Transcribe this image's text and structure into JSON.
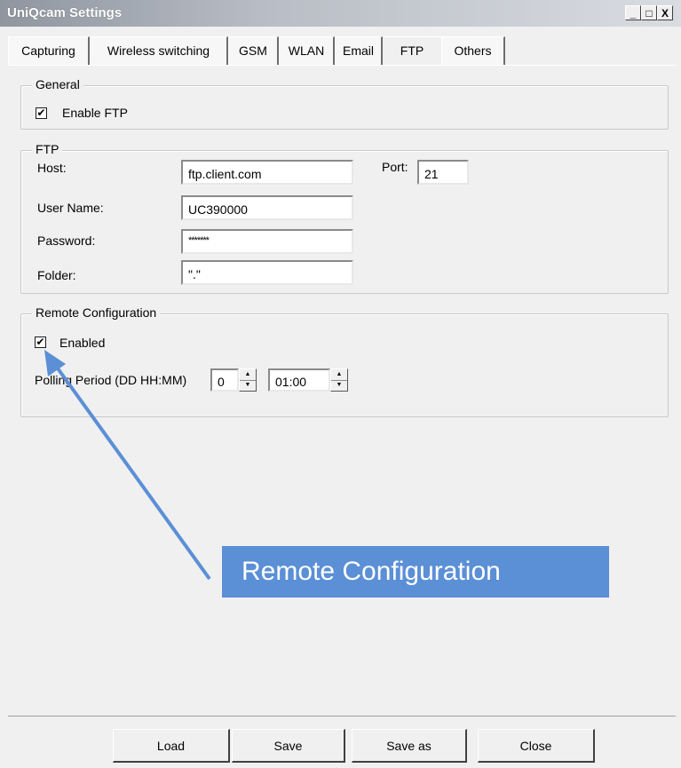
{
  "window": {
    "title": "UniQcam Settings",
    "controls": [
      "_",
      "□",
      "X"
    ]
  },
  "tabs": [
    {
      "label": "Capturing",
      "active": false
    },
    {
      "label": "Wireless switching",
      "active": false
    },
    {
      "label": "GSM",
      "active": false
    },
    {
      "label": "WLAN",
      "active": false
    },
    {
      "label": "Email",
      "active": false
    },
    {
      "label": "FTP",
      "active": true
    },
    {
      "label": "Others",
      "active": false
    }
  ],
  "general": {
    "title": "General",
    "enable_ftp": {
      "label": "Enable FTP",
      "checked": true
    }
  },
  "ftp": {
    "title": "FTP",
    "host_label": "Host:",
    "host_value": "ftp.client.com",
    "port_label": "Port:",
    "port_value": "21",
    "username_label": "User Name:",
    "username_value": "UC390000",
    "password_label": "Password:",
    "password_value": "*******",
    "folder_label": "Folder:",
    "folder_value": "\".\""
  },
  "remote": {
    "title": "Remote Configuration",
    "enabled": {
      "label": "Enabled",
      "checked": true
    },
    "polling_label": "Polling Period (DD HH:MM)",
    "polling_days": "0",
    "polling_time": "01:00"
  },
  "annotation": {
    "callout_text": "Remote Configuration",
    "callout_color": "#5b8fd6",
    "arrow_color": "#5b8fd6"
  },
  "buttons": {
    "load": "Load",
    "save": "Save",
    "save_as": "Save as",
    "close": "Close"
  },
  "icons": {
    "check": "✔",
    "spin_up": "▲",
    "spin_down": "▼"
  }
}
